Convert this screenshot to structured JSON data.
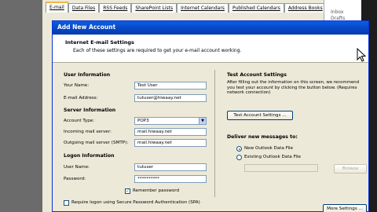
{
  "background_window": {
    "tabs": [
      {
        "label": "E-mail",
        "active": true
      },
      {
        "label": "Data Files",
        "active": false
      },
      {
        "label": "RSS Feeds",
        "active": false
      },
      {
        "label": "SharePoint Lists",
        "active": false
      },
      {
        "label": "Internet Calendars",
        "active": false
      },
      {
        "label": "Published Calendars",
        "active": false
      },
      {
        "label": "Address Books",
        "active": false
      }
    ],
    "side_text": [
      "Inbox",
      "Drafts"
    ]
  },
  "dialog": {
    "title": "Add New Account",
    "header_title": "Internet E-mail Settings",
    "header_desc": "Each of these settings are required to get your e-mail account working."
  },
  "user_info": {
    "heading": "User Information",
    "your_name_label": "Your Name:",
    "your_name_value": "Test User",
    "email_label": "E-mail Address:",
    "email_value": "tutuser@hiwaay.net"
  },
  "server_info": {
    "heading": "Server Information",
    "account_type_label": "Account Type:",
    "account_type_value": "POP3",
    "incoming_label": "Incoming mail server:",
    "incoming_value": "mail.hiwaay.net",
    "outgoing_label": "Outgoing mail server (SMTP):",
    "outgoing_value": "mail.hiwaay.net"
  },
  "logon_info": {
    "heading": "Logon Information",
    "username_label": "User Name:",
    "username_value": "tutuser",
    "password_label": "Password:",
    "password_value": "**********",
    "remember_label": "Remember password",
    "remember_checked": true,
    "spa_label": "Require logon using Secure Password Authentication (SPA)",
    "spa_checked": false
  },
  "test_settings": {
    "heading": "Test Account Settings",
    "desc": "After filling out the information on this screen, we recommend you test your account by clicking the button below. (Requires network connection)",
    "button_label": "Test Account Settings ..."
  },
  "deliver": {
    "heading": "Deliver new messages to:",
    "option_new": "New Outlook Data File",
    "option_existing": "Existing Outlook Data File",
    "selected": "new",
    "browse_label": "Browse"
  },
  "more_settings_label": "More Settings ..."
}
